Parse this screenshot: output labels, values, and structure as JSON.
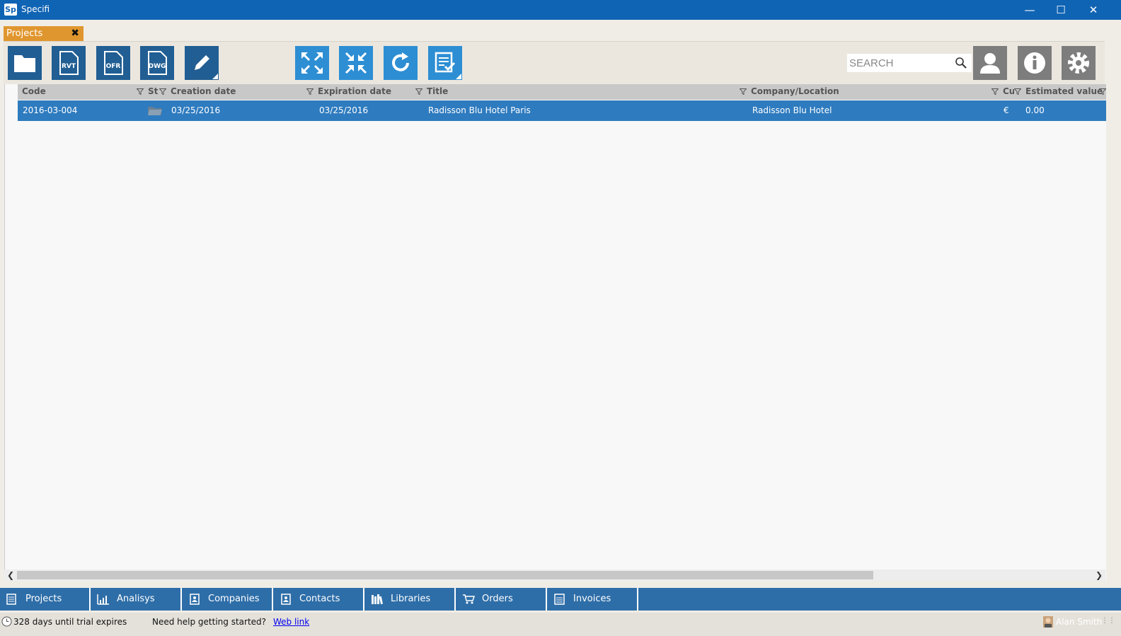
{
  "window": {
    "title": "Specifi",
    "icon_text": "Sp"
  },
  "doc_tab": {
    "label": "Projects"
  },
  "search": {
    "placeholder": "SEARCH"
  },
  "grid": {
    "columns": [
      "Code",
      "Sta",
      "Creation date",
      "Expiration date",
      "Title",
      "Company/Location",
      "Cu",
      "Estimated value"
    ],
    "rows": [
      {
        "code": "2016-03-004",
        "creation_date": "03/25/2016",
        "expiration_date": "03/25/2016",
        "title": "Radisson Blu Hotel Paris",
        "company": "Radisson Blu Hotel",
        "currency": "€",
        "estimated_value": "0.00"
      }
    ]
  },
  "nav": [
    {
      "label": "Projects"
    },
    {
      "label": "Analisys"
    },
    {
      "label": "Companies"
    },
    {
      "label": "Contacts"
    },
    {
      "label": "Libraries"
    },
    {
      "label": "Orders"
    },
    {
      "label": "Invoices"
    }
  ],
  "status": {
    "trial": "328 days until trial expires",
    "help": "Need help getting started?",
    "link": "Web link",
    "user": "Alan Smith"
  },
  "toolbar": {
    "rvt": "RVT",
    "ofr": "OFR",
    "dwg": "DWG"
  },
  "colors": {
    "titlebar": "#1064b4",
    "tab_accent": "#e0962e",
    "selected_row": "#2e7bbf",
    "nav": "#2e6ea8"
  }
}
